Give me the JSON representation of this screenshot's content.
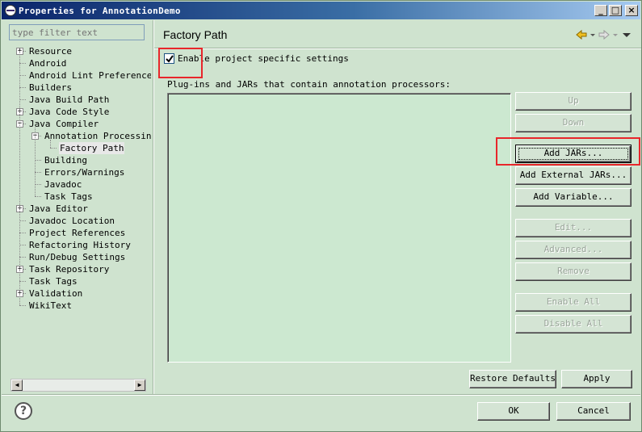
{
  "window": {
    "title": "Properties for AnnotationDemo",
    "minimize_label": "_",
    "maximize_label": "□",
    "close_label": "×"
  },
  "filter": {
    "placeholder": "type filter text"
  },
  "tree": {
    "items": [
      {
        "label": "Resource",
        "level": 0,
        "expander": "+"
      },
      {
        "label": "Android",
        "level": 0
      },
      {
        "label": "Android Lint Preferences",
        "level": 0
      },
      {
        "label": "Builders",
        "level": 0
      },
      {
        "label": "Java Build Path",
        "level": 0
      },
      {
        "label": "Java Code Style",
        "level": 0,
        "expander": "+"
      },
      {
        "label": "Java Compiler",
        "level": 0,
        "expander": "−"
      },
      {
        "label": "Annotation Processing",
        "level": 1,
        "expander": "−"
      },
      {
        "label": "Factory Path",
        "level": 2,
        "selected": true
      },
      {
        "label": "Building",
        "level": 1
      },
      {
        "label": "Errors/Warnings",
        "level": 1
      },
      {
        "label": "Javadoc",
        "level": 1
      },
      {
        "label": "Task Tags",
        "level": 1
      },
      {
        "label": "Java Editor",
        "level": 0,
        "expander": "+"
      },
      {
        "label": "Javadoc Location",
        "level": 0
      },
      {
        "label": "Project References",
        "level": 0
      },
      {
        "label": "Refactoring History",
        "level": 0
      },
      {
        "label": "Run/Debug Settings",
        "level": 0
      },
      {
        "label": "Task Repository",
        "level": 0,
        "expander": "+"
      },
      {
        "label": "Task Tags",
        "level": 0
      },
      {
        "label": "Validation",
        "level": 0,
        "expander": "+"
      },
      {
        "label": "WikiText",
        "level": 0
      }
    ],
    "scroll_left": "◀",
    "scroll_right": "▶"
  },
  "page": {
    "title": "Factory Path",
    "enable_checkbox": {
      "label": "Enable project specific settings",
      "checked": true
    },
    "list_label": "Plug-ins and JARs that contain annotation processors:",
    "buttons": {
      "up": "Up",
      "down": "Down",
      "add_jars": "Add JARs...",
      "add_external_jars": "Add External JARs...",
      "add_variable": "Add Variable...",
      "edit": "Edit...",
      "advanced": "Advanced...",
      "remove": "Remove",
      "enable_all": "Enable All",
      "disable_all": "Disable All"
    },
    "restore_defaults": "Restore Defaults",
    "apply": "Apply"
  },
  "dialog": {
    "help_label": "?",
    "ok": "OK",
    "cancel": "Cancel"
  },
  "colors": {
    "background": "#cfe3cf",
    "list_background": "#cce8d0",
    "highlight": "#e8262b",
    "title_gradient_start": "#0a246a",
    "title_gradient_end": "#a6caf0"
  }
}
